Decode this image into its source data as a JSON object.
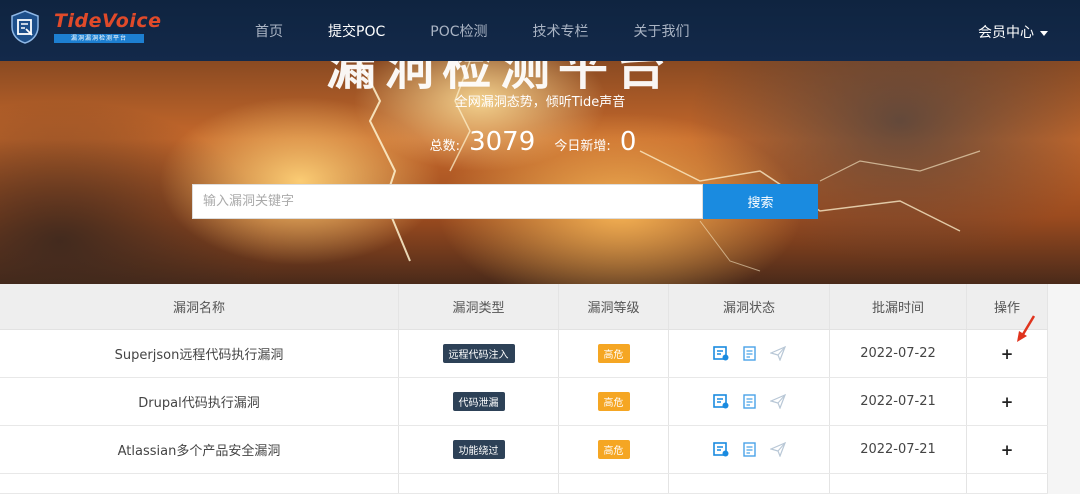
{
  "brand": {
    "name": "TideVoice",
    "tagline": "漏洞漏洞检测平台"
  },
  "nav": {
    "items": [
      {
        "label": "首页",
        "active": false
      },
      {
        "label": "提交POC",
        "active": true
      },
      {
        "label": "POC检测",
        "active": false
      },
      {
        "label": "技术专栏",
        "active": false
      },
      {
        "label": "关于我们",
        "active": false
      }
    ],
    "member": "会员中心"
  },
  "hero": {
    "title": "漏洞检测平台",
    "subtitle": "全网漏洞态势，倾听Tide声音",
    "total_label": "总数:",
    "total_value": "3079",
    "today_label": "今日新增:",
    "today_value": "0"
  },
  "search": {
    "placeholder": "输入漏洞关键字",
    "button": "搜索"
  },
  "table": {
    "headers": [
      "漏洞名称",
      "漏洞类型",
      "漏洞等级",
      "漏洞状态",
      "批漏时间",
      "操作"
    ],
    "rows": [
      {
        "name": "Superjson远程代码执行漏洞",
        "type": "远程代码注入",
        "level": "高危",
        "date": "2022-07-22",
        "op": "+"
      },
      {
        "name": "Drupal代码执行漏洞",
        "type": "代码泄漏",
        "level": "高危",
        "date": "2022-07-21",
        "op": "+"
      },
      {
        "name": "Atlassian多个产品安全漏洞",
        "type": "功能绕过",
        "level": "高危",
        "date": "2022-07-21",
        "op": "+"
      }
    ]
  },
  "colors": {
    "navbar": "#13294a",
    "accent": "#1a8be0",
    "type_badge": "#2d4157",
    "level_badge": "#f5a623",
    "arrow": "#e0341e"
  }
}
